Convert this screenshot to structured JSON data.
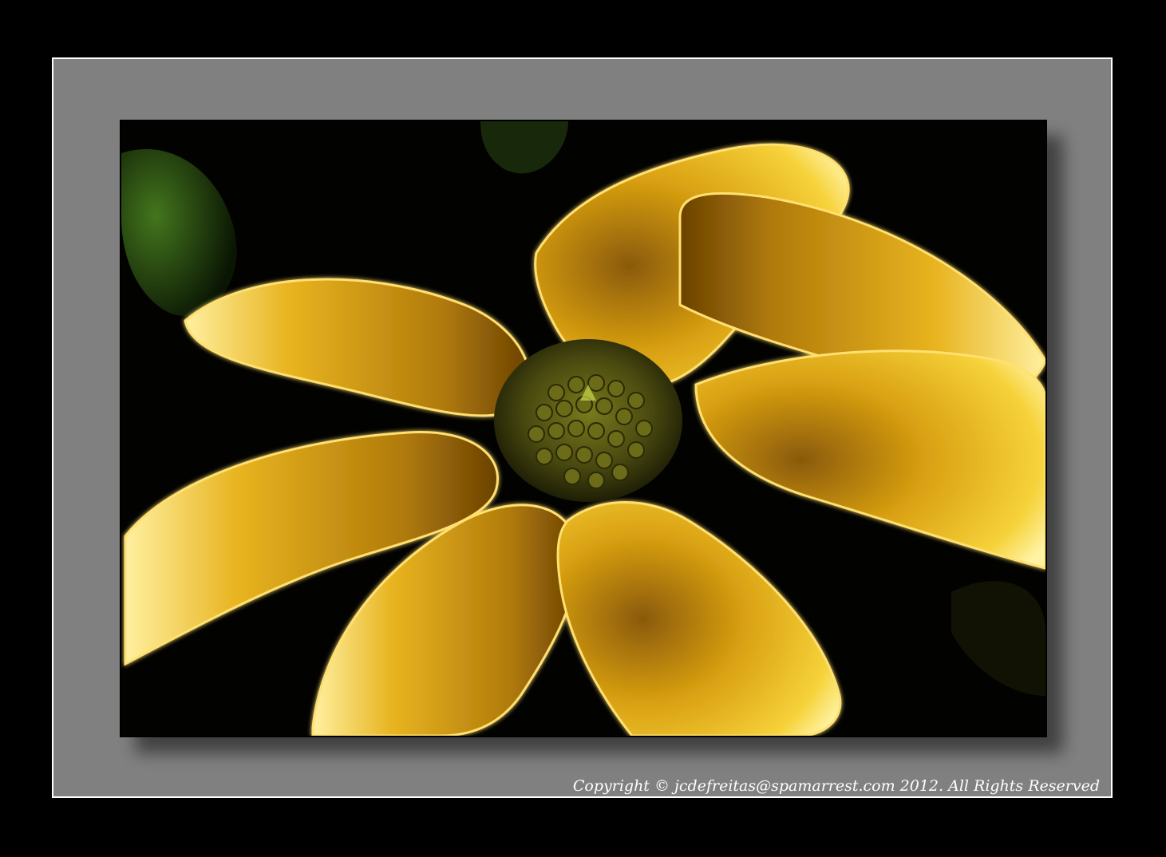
{
  "image": {
    "subject": "yellow-flower-icon",
    "colors": {
      "background": "#000000",
      "frame": "#808080",
      "frame_border": "#ffffff",
      "petal_light": "#f6d23a",
      "petal_mid": "#d9a012",
      "petal_dark": "#8a5a06",
      "center": "#4a4a10",
      "leaf": "#2f5a14"
    }
  },
  "copyright": {
    "text": "Copyright © jcdefreitas@spamarrest.com 2012. All Rights Reserved"
  }
}
